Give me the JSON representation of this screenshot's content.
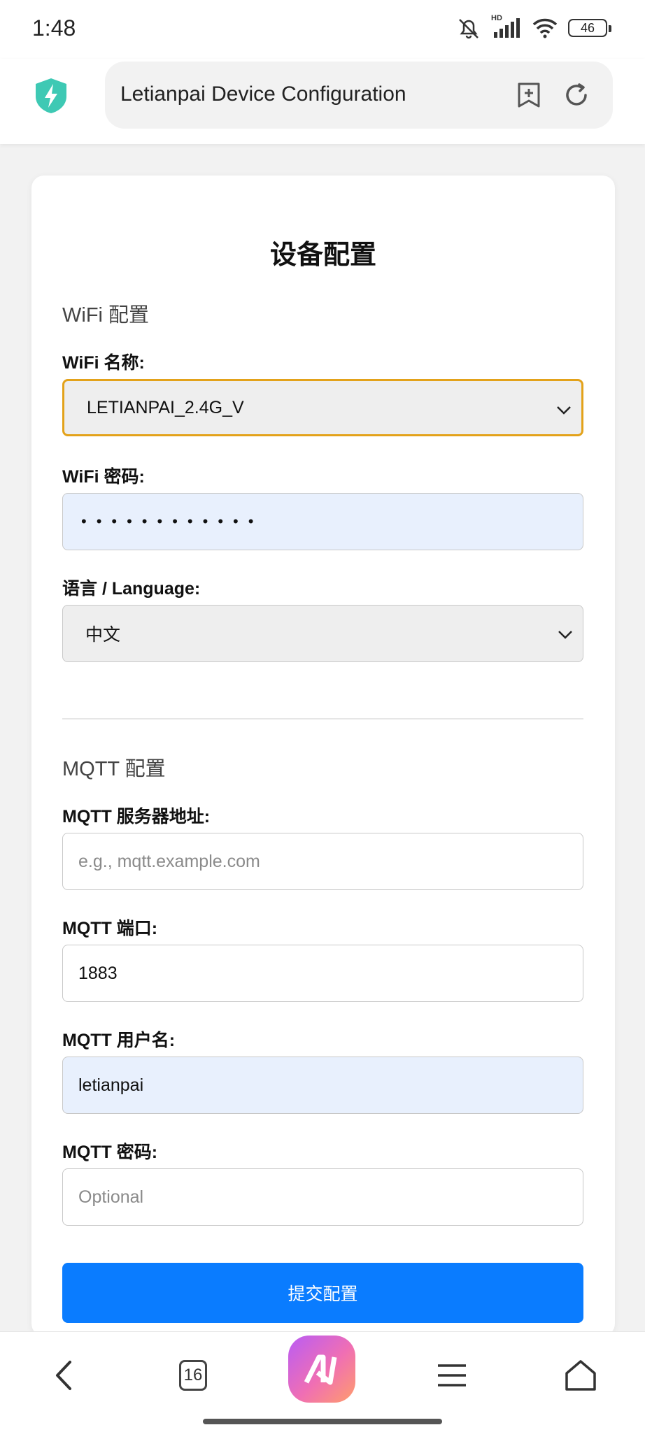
{
  "status_bar": {
    "time": "1:48",
    "battery": "46",
    "signal_label": "HD"
  },
  "browser": {
    "url_title": "Letianpai Device Configuration",
    "tab_count": "16"
  },
  "form": {
    "title": "设备配置",
    "wifi_section": "WiFi 配置",
    "wifi_name_label": "WiFi 名称:",
    "wifi_name_value": "LETIANPAI_2.4G_V",
    "wifi_password_label": "WiFi 密码:",
    "wifi_password_mask": "••••••••••••",
    "language_label": "语言 / Language:",
    "language_value": "中文",
    "mqtt_section": "MQTT 配置",
    "mqtt_server_label": "MQTT 服务器地址:",
    "mqtt_server_placeholder": "e.g., mqtt.example.com",
    "mqtt_port_label": "MQTT 端口:",
    "mqtt_port_value": "1883",
    "mqtt_user_label": "MQTT 用户名:",
    "mqtt_user_value": "letianpai",
    "mqtt_password_label": "MQTT 密码:",
    "mqtt_password_placeholder": "Optional",
    "submit_label": "提交配置"
  },
  "colors": {
    "accent": "#0a7cff",
    "focus_border": "#e3a21a",
    "autofill_bg": "#e8f0fd",
    "shield": "#3ec9b4"
  }
}
